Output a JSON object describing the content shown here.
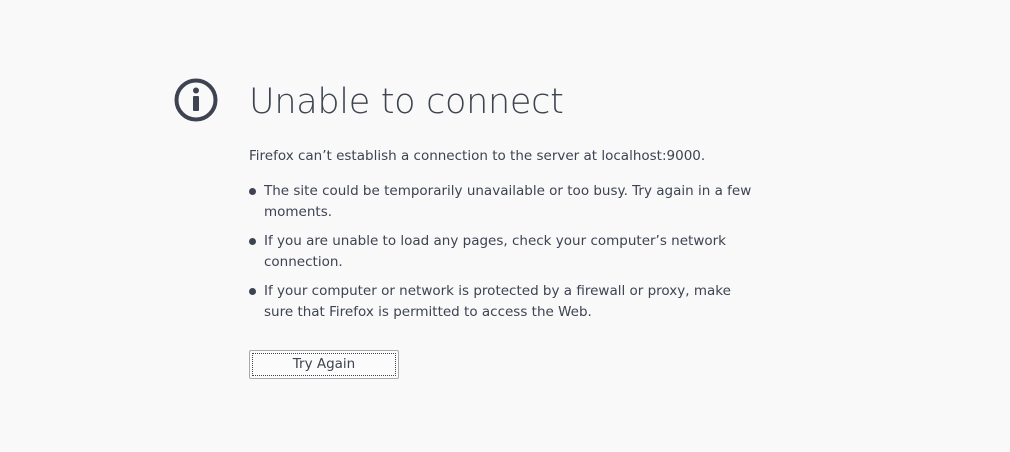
{
  "icon": "info-icon",
  "colors": {
    "background": "#f9f9fa",
    "text": "#3d4350",
    "icon": "#3d4350",
    "button_border": "#a9a9a9"
  },
  "title": "Unable to connect",
  "description": "Firefox can’t establish a connection to the server at localhost:9000.",
  "reasons": [
    "The site could be temporarily unavailable or too busy. Try again in a few moments.",
    "If you are unable to load any pages, check your computer’s network connection.",
    "If your computer or network is protected by a firewall or proxy, make sure that Firefox is permitted to access the Web."
  ],
  "button": {
    "label": "Try Again"
  }
}
